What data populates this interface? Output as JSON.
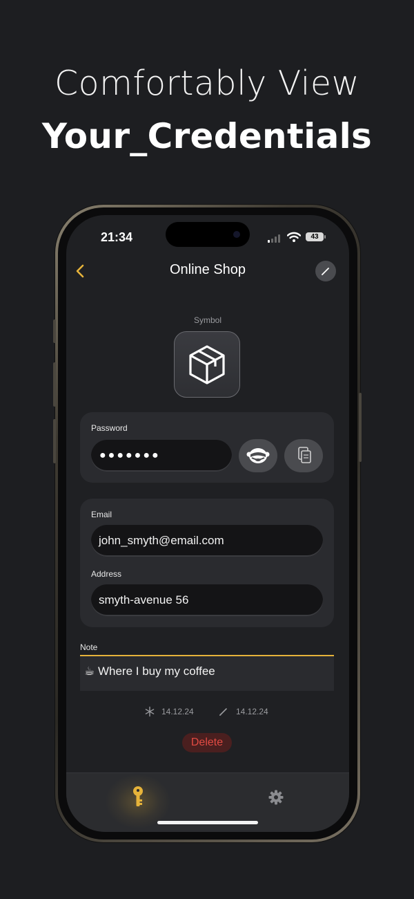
{
  "hero": {
    "line1": "Comfortably View",
    "line2": "Your_Credentials"
  },
  "status_bar": {
    "time": "21:34",
    "battery": "43"
  },
  "nav": {
    "back_icon": "chevron-left-icon",
    "title": "Online Shop",
    "edit_icon": "pencil-icon"
  },
  "symbol": {
    "label": "Symbol",
    "icon": "shipping-box-icon"
  },
  "password": {
    "label": "Password",
    "masked_value": "●●●●●●●",
    "reveal_icon": "see-no-evil-monkey-icon",
    "copy_icon": "copy-icon"
  },
  "email": {
    "label": "Email",
    "value": "john_smyth@email.com"
  },
  "address": {
    "label": "Address",
    "value": "smyth-avenue 56"
  },
  "note": {
    "label": "Note",
    "value": "☕ Where I buy my coffee"
  },
  "meta": {
    "created": "14.12.24",
    "modified": "14.12.24"
  },
  "delete_label": "Delete",
  "tabbar": {
    "items": [
      {
        "icon": "key-icon",
        "active": true
      },
      {
        "icon": "gear-icon",
        "active": false
      }
    ]
  },
  "colors": {
    "accent": "#e6b33a",
    "background": "#1d1e21",
    "card": "#2a2b2f",
    "danger": "#e24b43"
  }
}
